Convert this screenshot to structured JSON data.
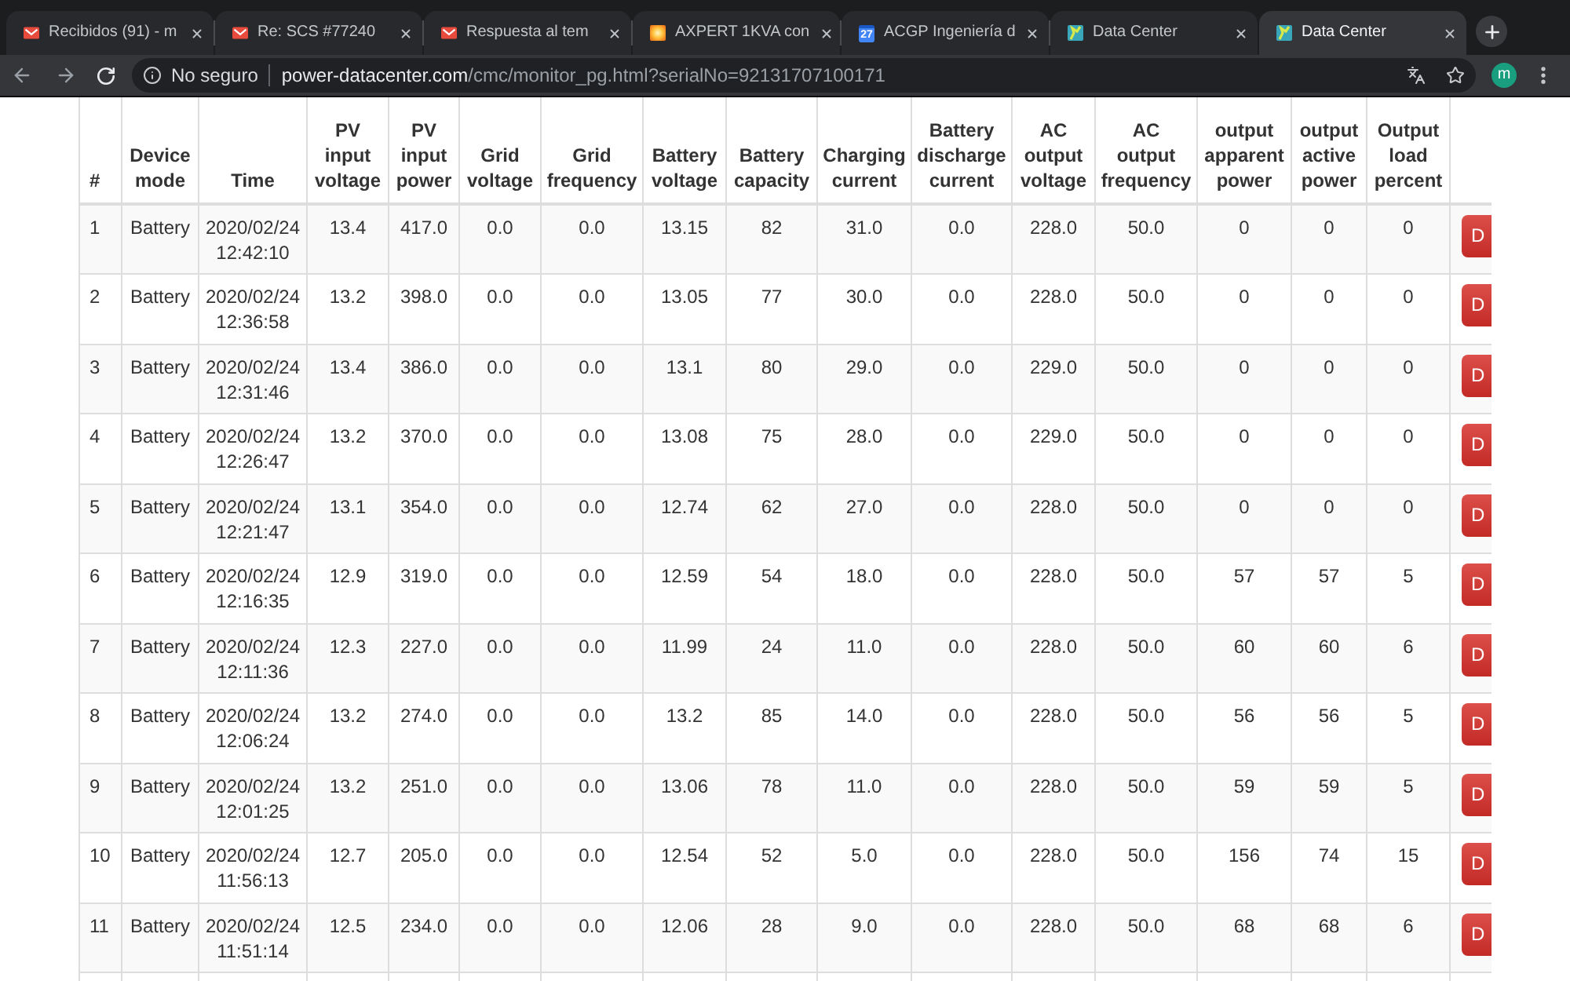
{
  "browser": {
    "tabs": [
      {
        "kind": "mail",
        "title": "Recibidos (91) - m",
        "selected": false
      },
      {
        "kind": "mail",
        "title": "Re: SCS #77240",
        "selected": false
      },
      {
        "kind": "mail",
        "title": "Respuesta al tem",
        "selected": false
      },
      {
        "kind": "photo",
        "title": "AXPERT 1KVA con",
        "selected": false
      },
      {
        "kind": "calendar",
        "icon_text": "27",
        "title": "ACGP Ingeniería d",
        "selected": false
      },
      {
        "kind": "site",
        "title": "Data Center",
        "selected": false
      },
      {
        "kind": "site",
        "title": "Data Center",
        "selected": true
      }
    ],
    "toolbar": {
      "security_label": "No seguro",
      "url_host": "power-datacenter.com",
      "url_path": "/cmc/monitor_pg.html?serialNo=92131707100171",
      "avatar_letter": "m"
    }
  },
  "table": {
    "columns": [
      "#",
      "Device mode",
      "Time",
      "PV input voltage",
      "PV input power",
      "Grid voltage",
      "Grid frequency",
      "Battery voltage",
      "Battery capacity",
      "Charging current",
      "Battery discharge current",
      "AC output voltage",
      "AC output frequency",
      "output apparent power",
      "output active power",
      "Output load percent"
    ],
    "rows": [
      {
        "cells": [
          "1",
          "Battery",
          "2020/02/24 12:42:10",
          "13.4",
          "417.0",
          "0.0",
          "0.0",
          "13.15",
          "82",
          "31.0",
          "0.0",
          "228.0",
          "50.0",
          "0",
          "0",
          "0"
        ],
        "action": "D"
      },
      {
        "cells": [
          "2",
          "Battery",
          "2020/02/24 12:36:58",
          "13.2",
          "398.0",
          "0.0",
          "0.0",
          "13.05",
          "77",
          "30.0",
          "0.0",
          "228.0",
          "50.0",
          "0",
          "0",
          "0"
        ],
        "action": "D"
      },
      {
        "cells": [
          "3",
          "Battery",
          "2020/02/24 12:31:46",
          "13.4",
          "386.0",
          "0.0",
          "0.0",
          "13.1",
          "80",
          "29.0",
          "0.0",
          "229.0",
          "50.0",
          "0",
          "0",
          "0"
        ],
        "action": "D"
      },
      {
        "cells": [
          "4",
          "Battery",
          "2020/02/24 12:26:47",
          "13.2",
          "370.0",
          "0.0",
          "0.0",
          "13.08",
          "75",
          "28.0",
          "0.0",
          "229.0",
          "50.0",
          "0",
          "0",
          "0"
        ],
        "action": "D"
      },
      {
        "cells": [
          "5",
          "Battery",
          "2020/02/24 12:21:47",
          "13.1",
          "354.0",
          "0.0",
          "0.0",
          "12.74",
          "62",
          "27.0",
          "0.0",
          "228.0",
          "50.0",
          "0",
          "0",
          "0"
        ],
        "action": "D"
      },
      {
        "cells": [
          "6",
          "Battery",
          "2020/02/24 12:16:35",
          "12.9",
          "319.0",
          "0.0",
          "0.0",
          "12.59",
          "54",
          "18.0",
          "0.0",
          "228.0",
          "50.0",
          "57",
          "57",
          "5"
        ],
        "action": "D"
      },
      {
        "cells": [
          "7",
          "Battery",
          "2020/02/24 12:11:36",
          "12.3",
          "227.0",
          "0.0",
          "0.0",
          "11.99",
          "24",
          "11.0",
          "0.0",
          "228.0",
          "50.0",
          "60",
          "60",
          "6"
        ],
        "action": "D"
      },
      {
        "cells": [
          "8",
          "Battery",
          "2020/02/24 12:06:24",
          "13.2",
          "274.0",
          "0.0",
          "0.0",
          "13.2",
          "85",
          "14.0",
          "0.0",
          "228.0",
          "50.0",
          "56",
          "56",
          "5"
        ],
        "action": "D"
      },
      {
        "cells": [
          "9",
          "Battery",
          "2020/02/24 12:01:25",
          "13.2",
          "251.0",
          "0.0",
          "0.0",
          "13.06",
          "78",
          "11.0",
          "0.0",
          "228.0",
          "50.0",
          "59",
          "59",
          "5"
        ],
        "action": "D"
      },
      {
        "cells": [
          "10",
          "Battery",
          "2020/02/24 11:56:13",
          "12.7",
          "205.0",
          "0.0",
          "0.0",
          "12.54",
          "52",
          "5.0",
          "0.0",
          "228.0",
          "50.0",
          "156",
          "74",
          "15"
        ],
        "action": "D"
      },
      {
        "cells": [
          "11",
          "Battery",
          "2020/02/24 11:51:14",
          "12.5",
          "234.0",
          "0.0",
          "0.0",
          "12.06",
          "28",
          "9.0",
          "0.0",
          "228.0",
          "50.0",
          "68",
          "68",
          "6"
        ],
        "action": "D"
      }
    ]
  }
}
